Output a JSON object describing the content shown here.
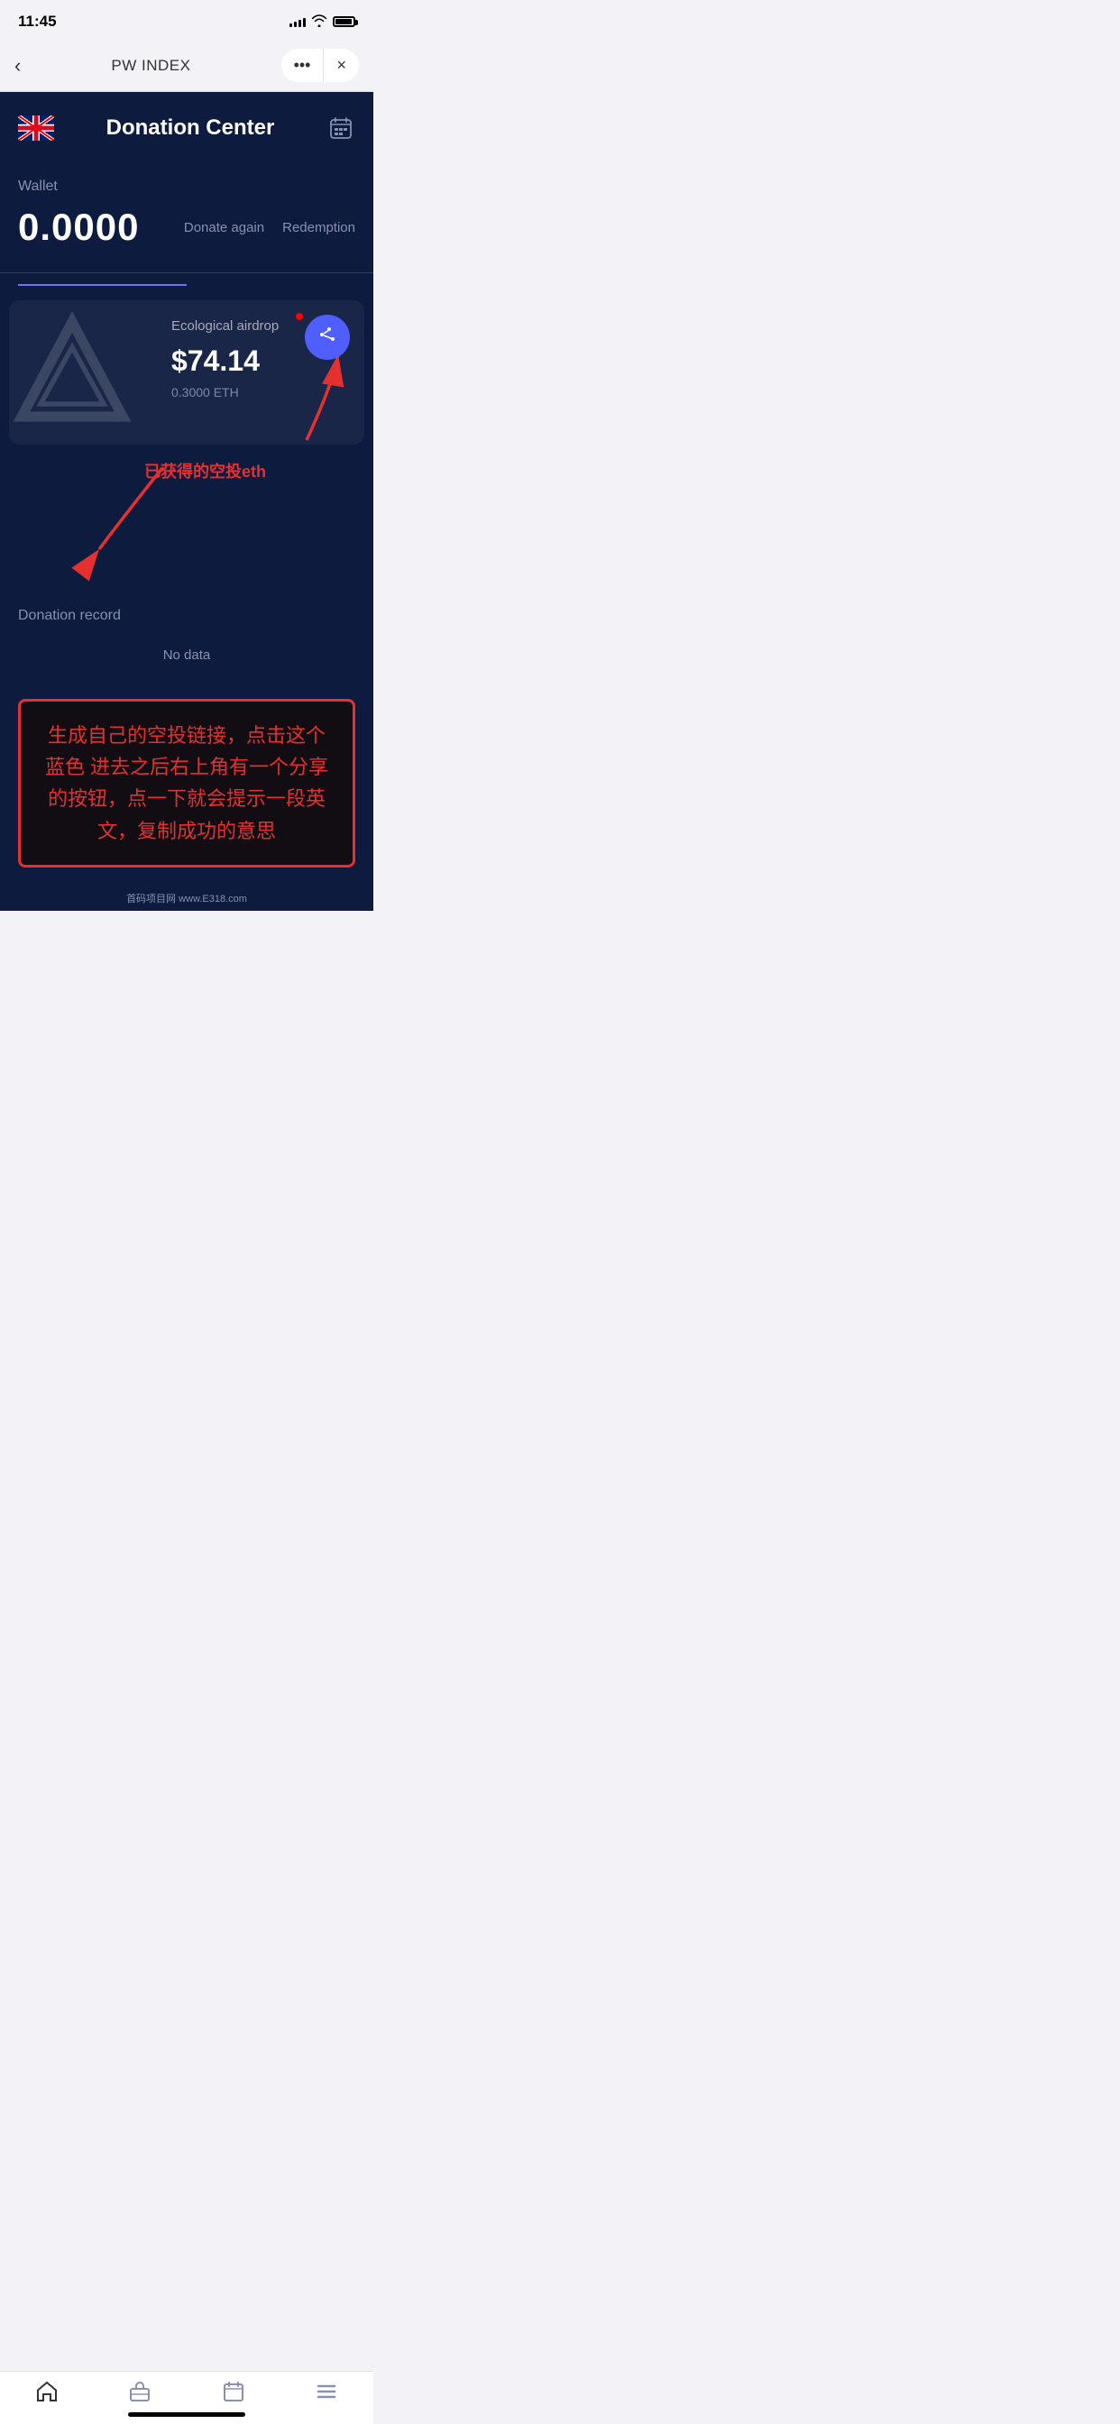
{
  "statusBar": {
    "time": "11:45"
  },
  "navBar": {
    "back": "<",
    "title": "PW INDEX",
    "dots": "•••",
    "close": "×"
  },
  "header": {
    "title": "Donation Center"
  },
  "wallet": {
    "label": "Wallet",
    "amount": "0.0000",
    "donateAgain": "Donate again",
    "redemption": "Redemption"
  },
  "tabs": [
    {
      "label": "",
      "active": true
    },
    {
      "label": "",
      "active": false
    }
  ],
  "airdropCard": {
    "label": "Ecological airdrop",
    "amountUsd": "$74.14",
    "amountEth": "0.3000 ETH"
  },
  "donationRecord": {
    "label": "Donation record",
    "noData": "No data"
  },
  "annotation": {
    "chineseText": "生成自己的空投链接，点击这个蓝色 进去之后右上角有一个分享的按钮，点一下就会提示一段英文，复制成功的意思",
    "arrowLabel1": "已获得的空投eth"
  },
  "bottomNav": {
    "home": "⌂",
    "briefcase": "💼",
    "calendar": "📅",
    "menu": "≡"
  },
  "website": {
    "label": "首码项目网 www.E318.com"
  }
}
